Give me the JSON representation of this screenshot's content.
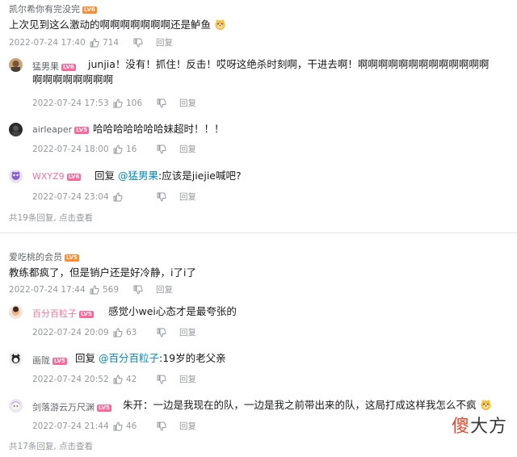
{
  "threads": [
    {
      "user": "凯尔希你有完没完",
      "text": "上次见到这么激动的啊啊啊啊啊啊啊还是鲈鱼",
      "date": "2022-07-24 17:40",
      "likes": "714",
      "reply_label": "回复",
      "replies": [
        {
          "user": "猛男果",
          "text_line1": "junjia！没有！抓住！反击！哎呀这绝杀时刻啊，干进去啊！啊啊啊啊啊啊啊啊啊啊啊啊啊",
          "text_line2": "啊啊啊啊啊啊啊啊",
          "date": "2022-07-24 17:53",
          "likes": "106",
          "reply_label": "回复"
        },
        {
          "user": "airleaper",
          "text": "哈哈哈哈哈哈哈妹超时！！！",
          "date": "2022-07-24 18:00",
          "likes": "16",
          "reply_label": "回复"
        },
        {
          "user": "WXYZ9",
          "prefix": "回复",
          "mention": "@猛男果",
          "text": ":应该是jiejie喊吧?",
          "date": "2022-07-24 23:04",
          "likes": "",
          "reply_label": "回复"
        }
      ],
      "more_text": "共19条回复, 点击查看"
    },
    {
      "user": "爱吃桃的会员",
      "text": "教练都疯了，但是销户还是好冷静，i了i了",
      "date": "2022-07-24 17:44",
      "likes": "569",
      "reply_label": "回复",
      "replies": [
        {
          "user": "百分百粒子",
          "text": "感觉小wei心态才是最夸张的",
          "date": "2022-07-24 20:09",
          "likes": "63",
          "reply_label": "回复"
        },
        {
          "user": "画陇",
          "prefix": "回复",
          "mention": "@百分百粒子",
          "text": ":19岁的老父亲",
          "date": "2022-07-24 20:52",
          "likes": "42",
          "reply_label": "回复"
        },
        {
          "user": "剑落游云万尺渊",
          "text": "朱开：一边是我现在的队，一边是我之前带出来的队，这局打成这样我怎么不疯",
          "date": "2022-07-24 21:44",
          "likes": "46",
          "reply_label": "回复"
        }
      ],
      "more_text": "共17条回复, 点击查看"
    }
  ],
  "level_badges": [
    "LV5",
    "LV6"
  ],
  "watermark": {
    "first": "傻",
    "rest": "大方"
  },
  "colors": {
    "pink_name": "#fb7299",
    "mention": "#008ac5",
    "meta": "#9499a0",
    "divider": "#e3e5e7"
  }
}
